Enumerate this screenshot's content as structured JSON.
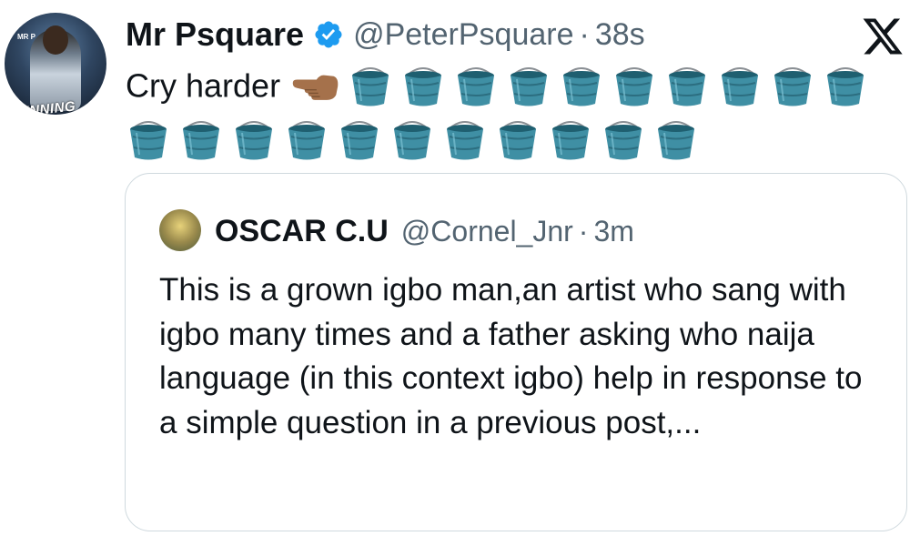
{
  "tweet": {
    "author_name": "Mr Psquare",
    "handle": "@PeterPsquare",
    "separator": "·",
    "time": "38s",
    "avatar_text": "WINNING",
    "avatar_small_text": "MR P",
    "text": "Cry harder",
    "emojis": [
      "pointing-left-hand-emoji",
      "bucket-emoji",
      "bucket-emoji",
      "bucket-emoji",
      "bucket-emoji",
      "bucket-emoji",
      "bucket-emoji",
      "bucket-emoji",
      "bucket-emoji",
      "bucket-emoji",
      "bucket-emoji",
      "bucket-emoji",
      "bucket-emoji",
      "bucket-emoji",
      "bucket-emoji",
      "bucket-emoji",
      "bucket-emoji",
      "bucket-emoji",
      "bucket-emoji",
      "bucket-emoji",
      "bucket-emoji",
      "bucket-emoji"
    ],
    "logo": "x-logo-icon",
    "badge": "verified-badge-icon"
  },
  "quoted_tweet": {
    "author_name": "OSCAR C.U",
    "handle": "@Cornel_Jnr",
    "separator": "·",
    "time": "3m",
    "text": "This is a grown igbo man,an artist who sang with igbo many times and a father asking who naija language (in this context igbo) help in response to a simple question in a previous post,..."
  },
  "colors": {
    "verified": "#1d9bf0",
    "secondary_text": "#536471",
    "border": "#cfd9de",
    "bucket": "#3f8fa4"
  }
}
